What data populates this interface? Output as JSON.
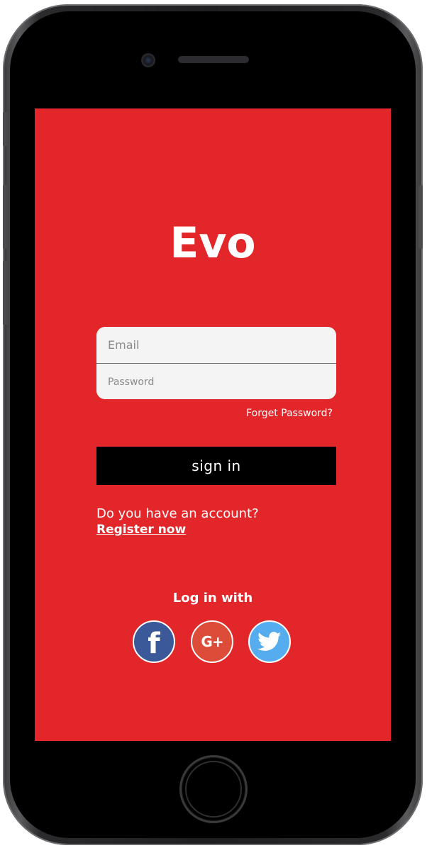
{
  "app": {
    "title": "Evo"
  },
  "login_form": {
    "email_placeholder": "Email",
    "password_placeholder": "Password",
    "forget_password_label": "Forget Password?",
    "sign_in_label": "sign in"
  },
  "register": {
    "question": "Do you have an account?",
    "link_label": "Register now"
  },
  "social_login": {
    "heading": "Log in with",
    "providers": [
      {
        "name": "facebook",
        "icon": "facebook-icon",
        "glyph": "f",
        "color": "#3b5998"
      },
      {
        "name": "google-plus",
        "icon": "google-plus-icon",
        "glyph": "G+",
        "color": "#dd4b39"
      },
      {
        "name": "twitter",
        "icon": "twitter-icon",
        "glyph": "",
        "color": "#55acee"
      }
    ]
  },
  "colors": {
    "background": "#e32629",
    "button": "#000000",
    "input_bg": "#f4f4f4",
    "text": "#ffffff"
  }
}
